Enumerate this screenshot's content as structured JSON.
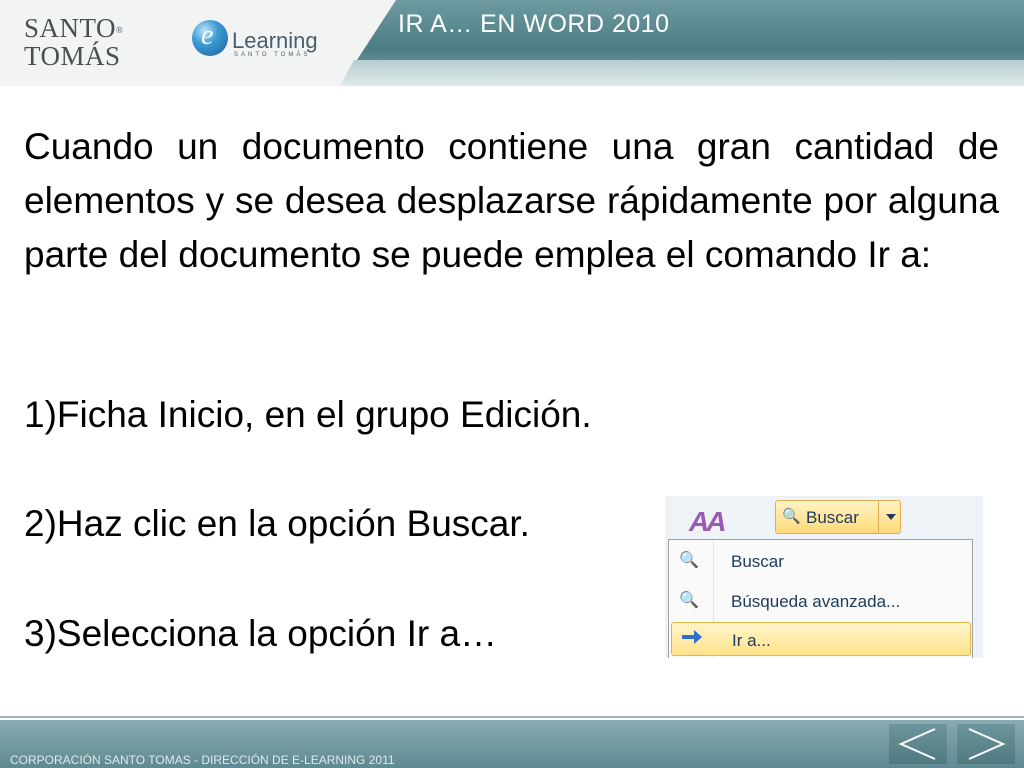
{
  "header": {
    "title": "IR A… EN WORD 2010",
    "logo_santo": "SANTO",
    "logo_tomas": "TOMÁS",
    "logo_trademark": "®",
    "elearning_mark": "e",
    "elearning_text": "Learning",
    "elearning_sub": "SANTO TOMÁS"
  },
  "body": {
    "paragraph": "Cuando un documento contiene una gran cantidad de elementos y se desea desplazarse rápidamente por alguna parte del documento se puede emplea el comando Ir a:",
    "steps": [
      "1)Ficha Inicio, en el grupo Edición.",
      "2)Haz clic en la opción Buscar.",
      "3)Selecciona la opción Ir a…"
    ]
  },
  "word_screenshot": {
    "button_label": "Buscar",
    "menu_items": [
      {
        "label": "Buscar",
        "icon": "binoculars-icon"
      },
      {
        "label": "Búsqueda avanzada...",
        "icon": "binoculars-icon"
      },
      {
        "label": "Ir a...",
        "icon": "arrow-right-icon"
      }
    ],
    "highlight_color": "#ffe38a"
  },
  "footer": {
    "text": "CORPORACIÓN SANTO TOMAS - DIRECCIÓN DE E-LEARNING  2011"
  },
  "colors": {
    "header_band": "#4c7d84",
    "footer_band": "#5f8a91"
  }
}
